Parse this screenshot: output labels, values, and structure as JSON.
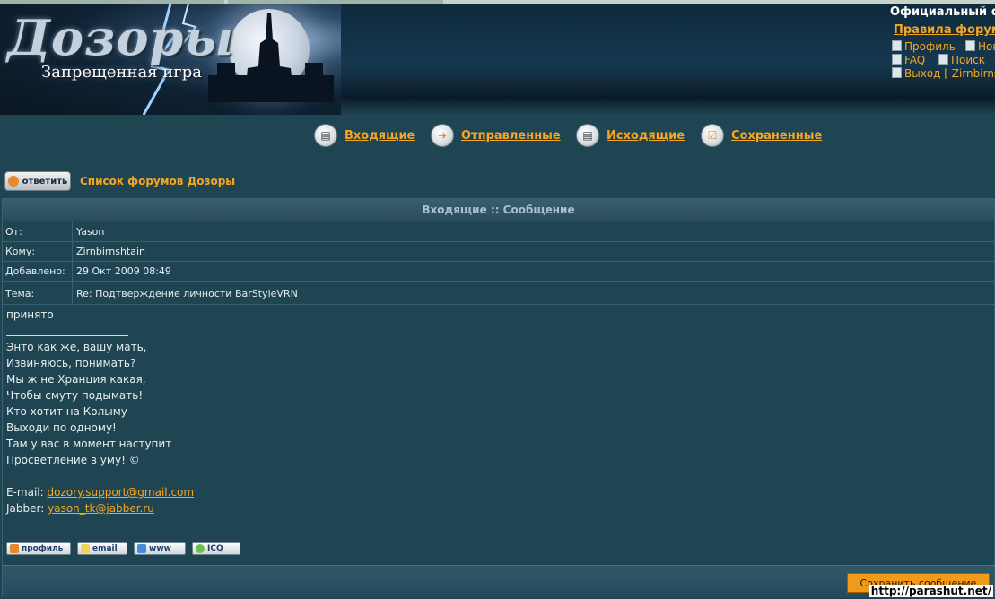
{
  "header": {
    "logo_title": "Дозоры",
    "logo_subtitle": "Запрещенная игра",
    "site_title": "Официальный ф",
    "rules_link": "Правила форума",
    "links": {
      "profile": "Профиль",
      "new": "Нов",
      "faq": "FAQ",
      "search": "Поиск",
      "logout": "Выход [ Zirnbirns"
    }
  },
  "folders": [
    {
      "label": "Входящие",
      "icon": "inbox-icon"
    },
    {
      "label": "Отправленные",
      "icon": "arrow-right-icon"
    },
    {
      "label": "Исходящие",
      "icon": "outbox-icon"
    },
    {
      "label": "Сохраненные",
      "icon": "checkbox-icon"
    }
  ],
  "reply_button": "ответить",
  "forum_index_link": "Список форумов Дозоры",
  "message": {
    "heading": "Входящие :: Сообщение",
    "fields": [
      {
        "label": "От:",
        "value": "Yason"
      },
      {
        "label": "Кому:",
        "value": "Zirnbirnshtain"
      },
      {
        "label": "Добавлено:",
        "value": "29 Окт 2009 08:49"
      },
      {
        "label": "Тема:",
        "value": "Re: Подтверждение личности BarStyleVRN"
      }
    ],
    "body_text": "принято",
    "signature_lines": [
      "Энто как же, вашу мать,",
      "Извиняюсь, понимать?",
      "Мы ж не Хранция какая,",
      "Чтобы смуту подымать!",
      "Кто хотит на Колыму -",
      "Выходи по одному!",
      "Там у вас в момент наступит",
      "Просветление в уму! ©"
    ],
    "email_label": "E-mail:",
    "email": "dozory.support@gmail.com",
    "jabber_label": "Jabber:",
    "jabber": "yason_tk@jabber.ru"
  },
  "profile_buttons": {
    "profile": "профиль",
    "email": "email",
    "www": "www",
    "icq": "ICQ"
  },
  "save_button": "Сохранить сообщение",
  "watermark": "http://parashut.net/"
}
